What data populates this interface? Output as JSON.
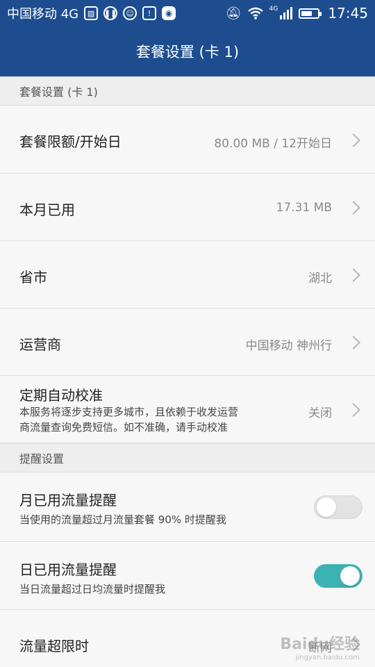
{
  "status_bar": {
    "carrier": "中国移动 4G",
    "time": "17:45",
    "network_badge": "4G",
    "battery_level": 0.7,
    "icons": [
      "image-icon",
      "pause-icon",
      "face-icon",
      "battery-saver-icon",
      "app-badge-icon",
      "mute-icon",
      "wifi-icon",
      "signal-icon",
      "battery-icon"
    ]
  },
  "header": {
    "title": "套餐设置 (卡 1)"
  },
  "sections": {
    "plan": {
      "title": "套餐设置 (卡 1)"
    },
    "reminder": {
      "title": "提醒设置"
    }
  },
  "rows": {
    "limit": {
      "title": "套餐限额/开始日",
      "value": "80.00 MB / 12开始日"
    },
    "used": {
      "title": "本月已用",
      "value": "17.31 MB"
    },
    "province": {
      "title": "省市",
      "value": "湖北"
    },
    "carrier": {
      "title": "运营商",
      "value": "中国移动 神州行"
    },
    "calibrate": {
      "title": "定期自动校准",
      "desc_line1": "本服务将逐步支持更多城市，且依赖于收发运营",
      "desc_line2": "商流量查询免费短信。如不准确，请手动校准",
      "value": "关闭"
    },
    "monthly_alert": {
      "title": "月已用流量提醒",
      "desc": "当使用的流量超过月流量套餐 90% 时提醒我",
      "enabled": false
    },
    "daily_alert": {
      "title": "日已用流量提醒",
      "desc": "当日流量超过日均流量时提醒我",
      "enabled": true
    },
    "over_limit": {
      "title": "流量超限时",
      "value": "断网"
    }
  },
  "watermark": {
    "brand": "Baidu经验",
    "url": "jingyan.baidu.com"
  },
  "colors": {
    "header_bg": "#1e4d8f",
    "switch_on": "#3cb3b2",
    "switch_off": "#e3e3e3"
  }
}
